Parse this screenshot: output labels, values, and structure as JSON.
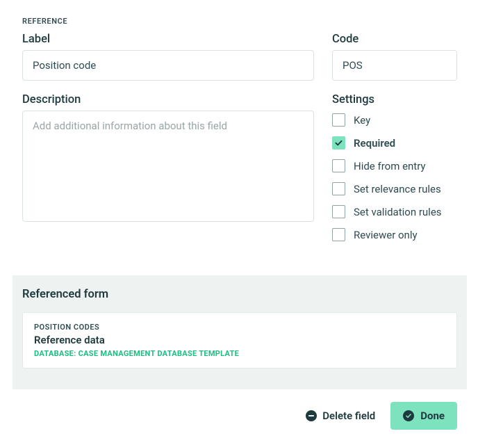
{
  "field_type": "REFERENCE",
  "label": {
    "caption": "Label",
    "value": "Position code"
  },
  "code": {
    "caption": "Code",
    "value": "POS"
  },
  "description": {
    "caption": "Description",
    "value": "",
    "placeholder": "Add additional information about this field"
  },
  "settings": {
    "caption": "Settings",
    "items": [
      {
        "label": "Key",
        "checked": false
      },
      {
        "label": "Required",
        "checked": true
      },
      {
        "label": "Hide from entry",
        "checked": false
      },
      {
        "label": "Set relevance rules",
        "checked": false
      },
      {
        "label": "Set validation rules",
        "checked": false
      },
      {
        "label": "Reviewer only",
        "checked": false
      }
    ]
  },
  "referenced_form": {
    "heading": "Referenced form",
    "form_name": "POSITION CODES",
    "type_label": "Reference data",
    "database_line": "DATABASE: CASE MANAGEMENT DATABASE TEMPLATE"
  },
  "footer": {
    "delete_label": "Delete field",
    "done_label": "Done"
  }
}
